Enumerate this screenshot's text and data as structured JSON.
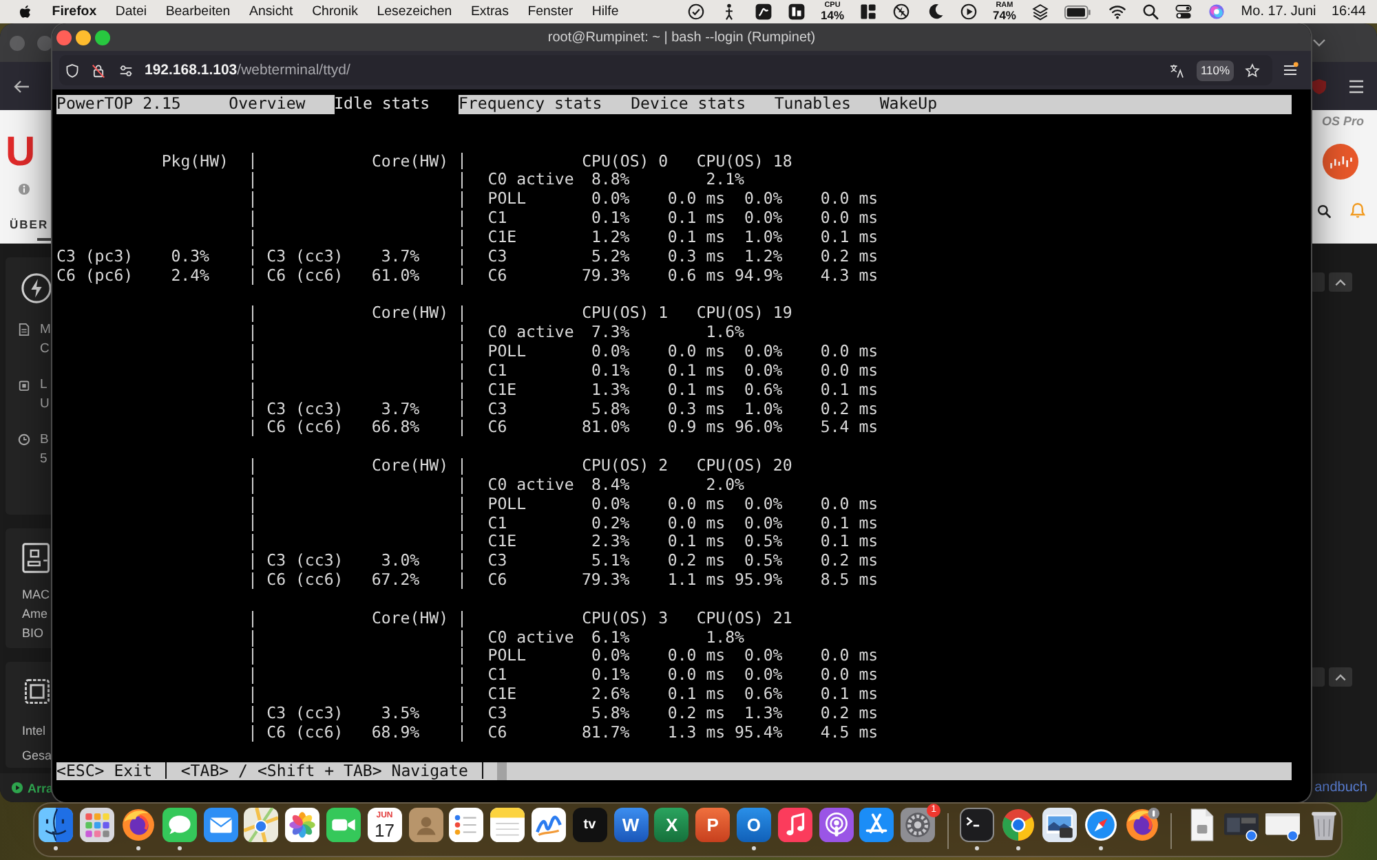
{
  "menu_bar": {
    "app": "Firefox",
    "menus": [
      "Datei",
      "Bearbeiten",
      "Ansicht",
      "Chronik",
      "Lesezeichen",
      "Extras",
      "Fenster",
      "Hilfe"
    ],
    "status_items": [
      {
        "kind": "check"
      },
      {
        "kind": "figure"
      },
      {
        "kind": "app_s"
      },
      {
        "kind": "app_b"
      },
      {
        "kind": "meter",
        "label": "CPU",
        "value": "14%"
      },
      {
        "kind": "layout"
      },
      {
        "kind": "bolt_off"
      },
      {
        "kind": "moon"
      },
      {
        "kind": "play"
      },
      {
        "kind": "meter",
        "label": "RAM",
        "value": "74%"
      },
      {
        "kind": "layers"
      },
      {
        "kind": "battery"
      },
      {
        "kind": "wifi"
      },
      {
        "kind": "search"
      },
      {
        "kind": "toggles"
      },
      {
        "kind": "orb"
      }
    ],
    "date": "Mo. 17. Juni",
    "time": "16:44"
  },
  "background_window": {
    "brand": "U",
    "nav_tab": "ÜBER",
    "info_items": [
      {
        "kind": "document",
        "lines": [
          "M",
          "C"
        ]
      },
      {
        "kind": "lock",
        "lines": [
          "L",
          "U"
        ]
      },
      {
        "kind": "clock",
        "lines": [
          "B",
          "5"
        ]
      }
    ],
    "cards": [
      {
        "kind": "board",
        "lines": [
          "MAC",
          "Ame",
          "BIO"
        ]
      },
      {
        "kind": "chip",
        "lines": [
          "Intel",
          "Gesa"
        ]
      }
    ],
    "status": "Arra",
    "right_brand": "OS Pro",
    "right_link": "andbuch"
  },
  "window": {
    "title": "root@Rumpinet: ~ | bash --login (Rumpinet)"
  },
  "address": {
    "host": "192.168.1.103",
    "path": "/webterminal/ttyd/",
    "zoom": "110%"
  },
  "terminal": {
    "title": "PowerTOP 2.15",
    "tabs": [
      {
        "label": "Overview",
        "selected": false
      },
      {
        "label": "Idle stats",
        "selected": true
      },
      {
        "label": "Frequency stats",
        "selected": false
      },
      {
        "label": "Device stats",
        "selected": false
      },
      {
        "label": "Tunables",
        "selected": false
      },
      {
        "label": "WakeUp",
        "selected": false
      }
    ],
    "blocks": [
      {
        "pkg_heading": "Pkg(HW)",
        "core_heading": "Core(HW)",
        "cpu_headings": [
          "CPU(OS) 0",
          "CPU(OS) 18"
        ],
        "rows": [
          {
            "kind": "active",
            "state": "C0 active",
            "pct_1": "8.8%",
            "pct_2": "2.1%"
          },
          {
            "kind": "state",
            "state": "POLL",
            "pct_1": "0.0%",
            "time_1": "0.0 ms",
            "pct_2": "0.0%",
            "time_2": "0.0 ms"
          },
          {
            "kind": "state",
            "state": "C1",
            "pct_1": "0.1%",
            "time_1": "0.1 ms",
            "pct_2": "0.0%",
            "time_2": "0.0 ms"
          },
          {
            "kind": "state",
            "state": "C1E",
            "pct_1": "1.2%",
            "time_1": "0.1 ms",
            "pct_2": "1.0%",
            "time_2": "0.1 ms"
          },
          {
            "kind": "state",
            "pkg_state": "C3 (pc3)",
            "pkg_value": "0.3%",
            "core_state": "C3 (cc3)",
            "core_value": "3.7%",
            "state": "C3",
            "pct_1": "5.2%",
            "time_1": "0.3 ms",
            "pct_2": "1.2%",
            "time_2": "0.2 ms"
          },
          {
            "kind": "state",
            "pkg_state": "C6 (pc6)",
            "pkg_value": "2.4%",
            "core_state": "C6 (cc6)",
            "core_value": "61.0%",
            "state": "C6",
            "pct_1": "79.3%",
            "time_1": "0.6 ms",
            "pct_2": "94.9%",
            "time_2": "4.3 ms"
          }
        ]
      },
      {
        "core_heading": "Core(HW)",
        "cpu_headings": [
          "CPU(OS) 1",
          "CPU(OS) 19"
        ],
        "rows": [
          {
            "kind": "active",
            "state": "C0 active",
            "pct_1": "7.3%",
            "pct_2": "1.6%"
          },
          {
            "kind": "state",
            "state": "POLL",
            "pct_1": "0.0%",
            "time_1": "0.0 ms",
            "pct_2": "0.0%",
            "time_2": "0.0 ms"
          },
          {
            "kind": "state",
            "state": "C1",
            "pct_1": "0.1%",
            "time_1": "0.1 ms",
            "pct_2": "0.0%",
            "time_2": "0.0 ms"
          },
          {
            "kind": "state",
            "state": "C1E",
            "pct_1": "1.3%",
            "time_1": "0.1 ms",
            "pct_2": "0.6%",
            "time_2": "0.1 ms"
          },
          {
            "kind": "state",
            "core_state": "C3 (cc3)",
            "core_value": "3.7%",
            "state": "C3",
            "pct_1": "5.8%",
            "time_1": "0.3 ms",
            "pct_2": "1.0%",
            "time_2": "0.2 ms"
          },
          {
            "kind": "state",
            "core_state": "C6 (cc6)",
            "core_value": "66.8%",
            "state": "C6",
            "pct_1": "81.0%",
            "time_1": "0.9 ms",
            "pct_2": "96.0%",
            "time_2": "5.4 ms"
          }
        ]
      },
      {
        "core_heading": "Core(HW)",
        "cpu_headings": [
          "CPU(OS) 2",
          "CPU(OS) 20"
        ],
        "rows": [
          {
            "kind": "active",
            "state": "C0 active",
            "pct_1": "8.4%",
            "pct_2": "2.0%"
          },
          {
            "kind": "state",
            "state": "POLL",
            "pct_1": "0.0%",
            "time_1": "0.0 ms",
            "pct_2": "0.0%",
            "time_2": "0.0 ms"
          },
          {
            "kind": "state",
            "state": "C1",
            "pct_1": "0.2%",
            "time_1": "0.0 ms",
            "pct_2": "0.0%",
            "time_2": "0.1 ms"
          },
          {
            "kind": "state",
            "state": "C1E",
            "pct_1": "2.3%",
            "time_1": "0.1 ms",
            "pct_2": "0.5%",
            "time_2": "0.1 ms"
          },
          {
            "kind": "state",
            "core_state": "C3 (cc3)",
            "core_value": "3.0%",
            "state": "C3",
            "pct_1": "5.1%",
            "time_1": "0.2 ms",
            "pct_2": "0.5%",
            "time_2": "0.2 ms"
          },
          {
            "kind": "state",
            "core_state": "C6 (cc6)",
            "core_value": "67.2%",
            "state": "C6",
            "pct_1": "79.3%",
            "time_1": "1.1 ms",
            "pct_2": "95.9%",
            "time_2": "8.5 ms"
          }
        ]
      },
      {
        "core_heading": "Core(HW)",
        "cpu_headings": [
          "CPU(OS) 3",
          "CPU(OS) 21"
        ],
        "rows": [
          {
            "kind": "active",
            "state": "C0 active",
            "pct_1": "6.1%",
            "pct_2": "1.8%"
          },
          {
            "kind": "state",
            "state": "POLL",
            "pct_1": "0.0%",
            "time_1": "0.0 ms",
            "pct_2": "0.0%",
            "time_2": "0.0 ms"
          },
          {
            "kind": "state",
            "state": "C1",
            "pct_1": "0.1%",
            "time_1": "0.0 ms",
            "pct_2": "0.0%",
            "time_2": "0.0 ms"
          },
          {
            "kind": "state",
            "state": "C1E",
            "pct_1": "2.6%",
            "time_1": "0.1 ms",
            "pct_2": "0.6%",
            "time_2": "0.1 ms"
          },
          {
            "kind": "state",
            "core_state": "C3 (cc3)",
            "core_value": "3.5%",
            "state": "C3",
            "pct_1": "5.8%",
            "time_1": "0.2 ms",
            "pct_2": "1.3%",
            "time_2": "0.2 ms"
          },
          {
            "kind": "state",
            "core_state": "C6 (cc6)",
            "core_value": "68.9%",
            "state": "C6",
            "pct_1": "81.7%",
            "time_1": "1.3 ms",
            "pct_2": "95.4%",
            "time_2": "4.5 ms"
          }
        ]
      }
    ],
    "status_bar": [
      "<ESC> Exit",
      "<TAB> / <Shift + TAB> Navigate"
    ]
  },
  "dock": {
    "items": [
      {
        "kind": "finder",
        "running": true
      },
      {
        "kind": "launchpad",
        "running": false
      },
      {
        "kind": "firefox",
        "running": true
      },
      {
        "kind": "messages",
        "running": true
      },
      {
        "kind": "mail",
        "running": false
      },
      {
        "kind": "maps",
        "running": false
      },
      {
        "kind": "photos",
        "running": false
      },
      {
        "kind": "facetime",
        "running": false
      },
      {
        "kind": "calendar",
        "month": "JUN",
        "day": "17",
        "running": false
      },
      {
        "kind": "contacts",
        "running": false
      },
      {
        "kind": "reminders",
        "running": false
      },
      {
        "kind": "notes",
        "running": false
      },
      {
        "kind": "freeform",
        "running": false
      },
      {
        "kind": "tv",
        "label": "tv",
        "running": false
      },
      {
        "kind": "word",
        "label": "W",
        "running": false
      },
      {
        "kind": "excel",
        "label": "X",
        "running": false
      },
      {
        "kind": "powerpoint",
        "label": "P",
        "running": false
      },
      {
        "kind": "outlook",
        "label": "O",
        "running": true
      },
      {
        "kind": "music",
        "running": false
      },
      {
        "kind": "podcasts",
        "running": false
      },
      {
        "kind": "appstore",
        "running": false
      },
      {
        "kind": "settings",
        "badge": "1",
        "running": false
      },
      {
        "kind": "separator"
      },
      {
        "kind": "terminal",
        "running": true
      },
      {
        "kind": "chrome",
        "running": true
      },
      {
        "kind": "preview",
        "running": false
      },
      {
        "kind": "safari",
        "running": true
      },
      {
        "kind": "firefox_badge",
        "running": false
      },
      {
        "kind": "separator"
      },
      {
        "kind": "document",
        "running": false
      },
      {
        "kind": "window_dark",
        "running": false
      },
      {
        "kind": "window_light",
        "running": false
      },
      {
        "kind": "trash",
        "running": false
      }
    ]
  }
}
